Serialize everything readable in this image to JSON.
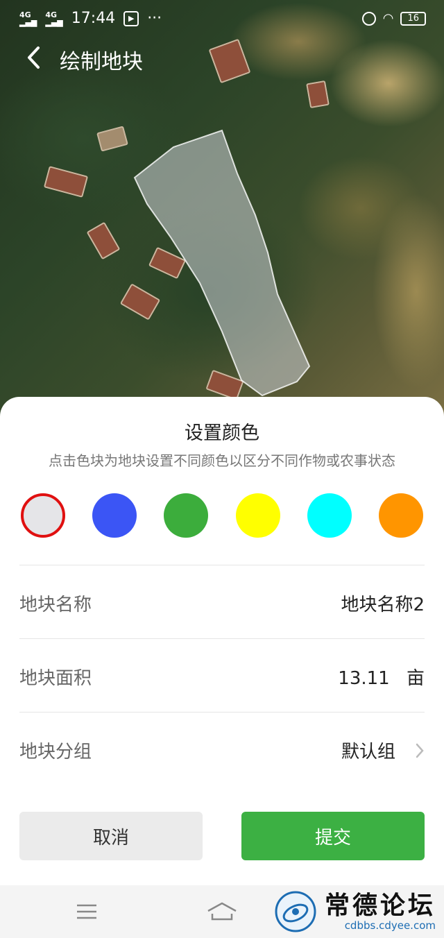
{
  "status_bar": {
    "network1": "4G",
    "network2": "4G",
    "time": "17:44",
    "more": "···",
    "battery": "16"
  },
  "app_bar": {
    "title": "绘制地块"
  },
  "sheet": {
    "title": "设置颜色",
    "subtitle": "点击色块为地块设置不同颜色以区分不同作物或农事状态",
    "colors": [
      "#e5e5e8",
      "#3b55f5",
      "#3cad3c",
      "#ffff00",
      "#00ffff",
      "#ff9500"
    ],
    "selected_color_index": 0,
    "selected_ring_color": "#e01010",
    "fields": {
      "name_label": "地块名称",
      "name_value": "地块名称2",
      "area_label": "地块面积",
      "area_value": "13.11",
      "area_unit": "亩",
      "group_label": "地块分组",
      "group_value": "默认组"
    },
    "cancel_label": "取消",
    "submit_label": "提交",
    "submit_color": "#3cb043"
  },
  "nav": {
    "menu_icon": "menu-icon",
    "home_icon": "home-icon",
    "back_icon": "back-icon"
  },
  "watermark": {
    "title": "常德论坛",
    "url": "cdbbs.cdyee.com"
  }
}
